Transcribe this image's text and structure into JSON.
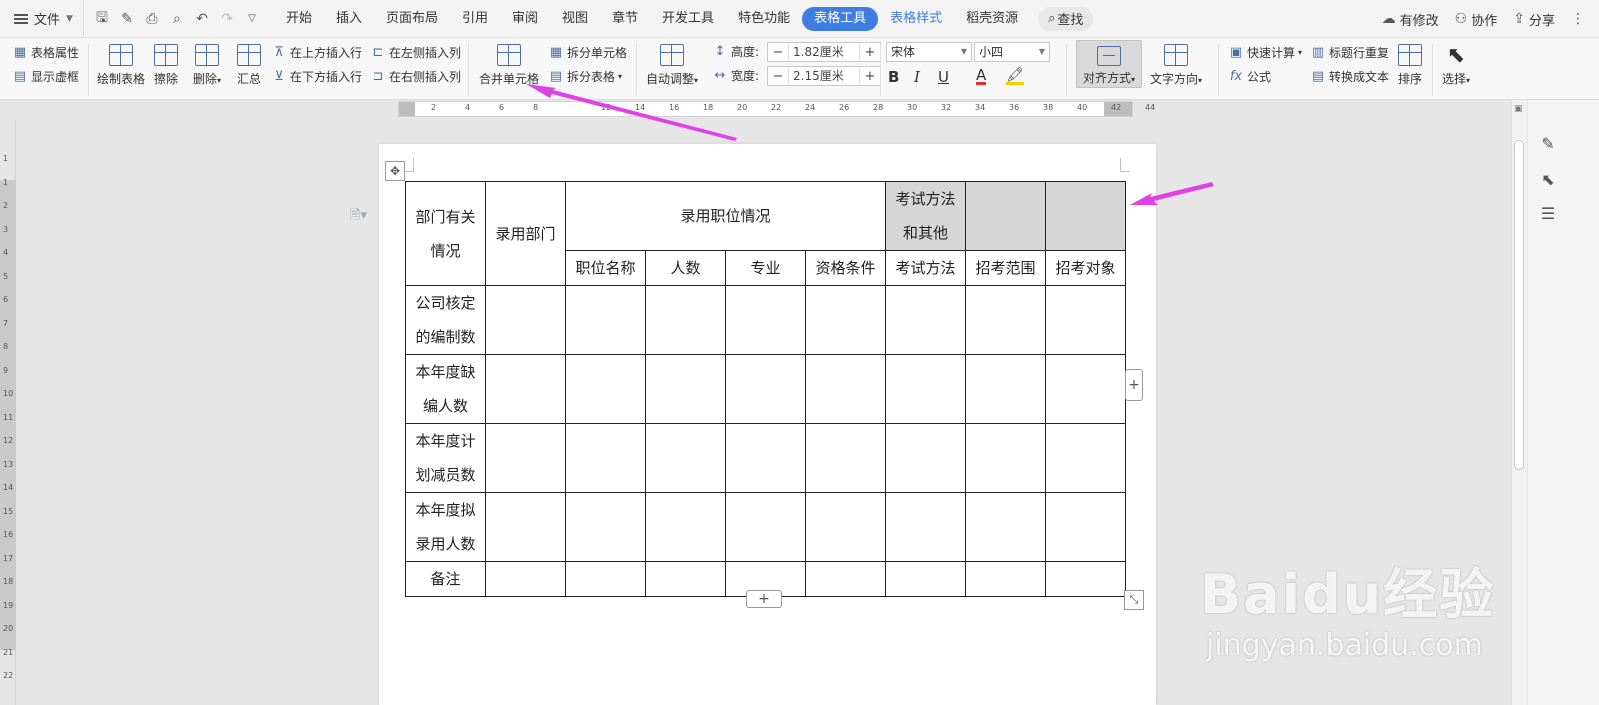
{
  "menubar": {
    "file_label": "文件",
    "tabs": [
      {
        "label": "开始"
      },
      {
        "label": "插入"
      },
      {
        "label": "页面布局"
      },
      {
        "label": "引用"
      },
      {
        "label": "审阅"
      },
      {
        "label": "视图"
      },
      {
        "label": "章节"
      },
      {
        "label": "开发工具"
      },
      {
        "label": "特色功能"
      },
      {
        "label": "表格工具"
      },
      {
        "label": "表格样式"
      },
      {
        "label": "稻壳资源"
      }
    ],
    "search_label": "查找",
    "right": {
      "modified": "有修改",
      "collab": "协作",
      "share": "分享"
    }
  },
  "ribbon": {
    "table_props": "表格属性",
    "show_grid": "显示虚框",
    "draw_table": "绘制表格",
    "erase": "擦除",
    "delete": "删除",
    "summary": "汇总",
    "insert_above": "在上方插入行",
    "insert_below": "在下方插入行",
    "insert_left": "在左侧插入列",
    "insert_right": "在右侧插入列",
    "merge_cells": "合并单元格",
    "split_cells": "拆分单元格",
    "split_table": "拆分表格",
    "auto_fit": "自动调整",
    "height_label": "高度:",
    "height_value": "1.82厘米",
    "width_label": "宽度:",
    "width_value": "2.15厘米",
    "font_name": "宋体",
    "font_size": "小四",
    "bold": "B",
    "italic": "I",
    "underline": "U",
    "font_color": "A",
    "align": "对齐方式",
    "text_direction": "文字方向",
    "quick_calc": "快速计算",
    "formula": "公式",
    "repeat_header": "标题行重复",
    "to_text": "转换成文本",
    "sort": "排序",
    "select": "选择"
  },
  "ruler": {
    "h_ticks": [
      "2",
      "4",
      "6",
      "8",
      "12",
      "14",
      "16",
      "18",
      "20",
      "22",
      "24",
      "26",
      "28",
      "30",
      "32",
      "34",
      "36",
      "38",
      "40",
      "42",
      "44"
    ],
    "v_ticks": [
      "1",
      "1",
      "2",
      "3",
      "4",
      "5",
      "6",
      "7",
      "8",
      "9",
      "10",
      "11",
      "12",
      "13",
      "14",
      "15",
      "16",
      "17",
      "18",
      "19",
      "20",
      "21",
      "22"
    ]
  },
  "table": {
    "h_dept_info": "部门有关情况",
    "h_hire_dept": "录用部门",
    "h_position": "录用职位情况",
    "h_exam_other": "考试方法和其他",
    "sub": [
      "职位名称",
      "人数",
      "专业",
      "资格条件",
      "考试方法",
      "招考范围",
      "招考对象"
    ],
    "rows": [
      {
        "label": "公司核定的编制数"
      },
      {
        "label": "本年度缺编人数"
      },
      {
        "label": "本年度计划减员数"
      },
      {
        "label": "本年度拟录用人数"
      },
      {
        "label": "备注"
      }
    ]
  },
  "controls": {
    "add_row": "+",
    "add_col": "+",
    "move": "✥",
    "resize": "⤡"
  },
  "watermark": {
    "logo": "Baidu经验",
    "url": "jingyan.baidu.com"
  },
  "colors": {
    "accent": "#3d7ee0",
    "arrow": "#e040e8",
    "shade": "#d6d6d6"
  }
}
